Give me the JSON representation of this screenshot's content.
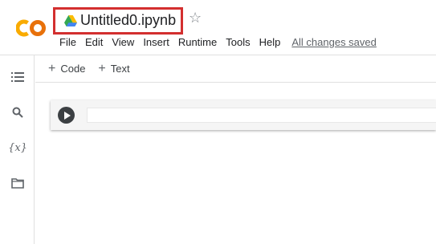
{
  "app": {
    "logo_text": "CO",
    "brand_colors": {
      "logo_left": "#f9ab00",
      "logo_right": "#e8710a"
    }
  },
  "notebook": {
    "title": "Untitled0.ipynb",
    "title_highlight_color": "#d32f2f",
    "drive_icon": "google-drive-icon",
    "star_icon": "star-outline-icon"
  },
  "menu": {
    "items": [
      "File",
      "Edit",
      "View",
      "Insert",
      "Runtime",
      "Tools",
      "Help"
    ],
    "status": "All changes saved"
  },
  "sidebar": {
    "items": [
      {
        "icon": "table-of-contents-icon"
      },
      {
        "icon": "search-icon"
      },
      {
        "icon": "variables-icon",
        "glyph": "{x}"
      },
      {
        "icon": "folder-icon"
      }
    ]
  },
  "toolbar": {
    "code_label": "Code",
    "text_label": "Text",
    "plus_glyph": "+"
  },
  "cell": {
    "run_icon": "play-icon",
    "content": ""
  }
}
